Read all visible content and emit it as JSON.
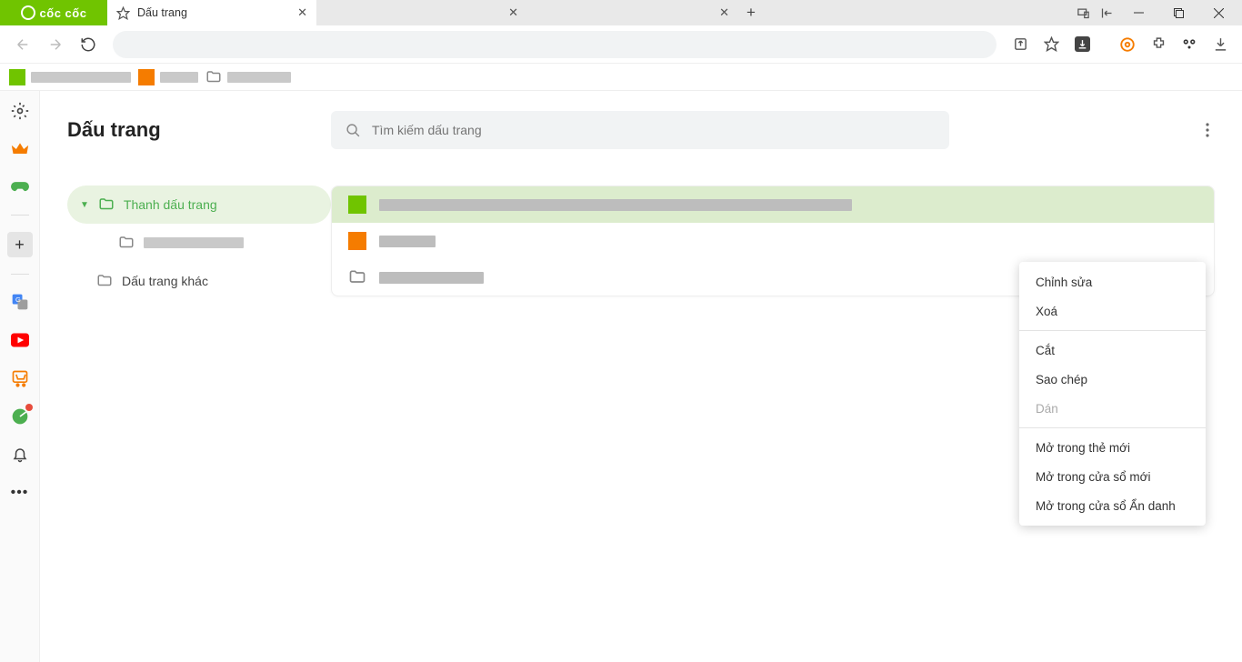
{
  "browser": {
    "brand": "cốc cốc",
    "tabs": [
      {
        "title": "Dấu trang",
        "active": true
      },
      {
        "title": "",
        "active": false
      },
      {
        "title": "",
        "active": false
      }
    ]
  },
  "page": {
    "title": "Dấu trang",
    "search_placeholder": "Tìm kiếm dấu trang"
  },
  "tree": {
    "root": "Thanh dấu trang",
    "other": "Dấu trang khác"
  },
  "context_menu": {
    "edit": "Chỉnh sửa",
    "delete": "Xoá",
    "cut": "Cắt",
    "copy": "Sao chép",
    "paste": "Dán",
    "open_tab": "Mở trong thẻ mới",
    "open_window": "Mở trong cửa sổ mới",
    "open_incognito": "Mở trong cửa sổ Ẩn danh"
  }
}
